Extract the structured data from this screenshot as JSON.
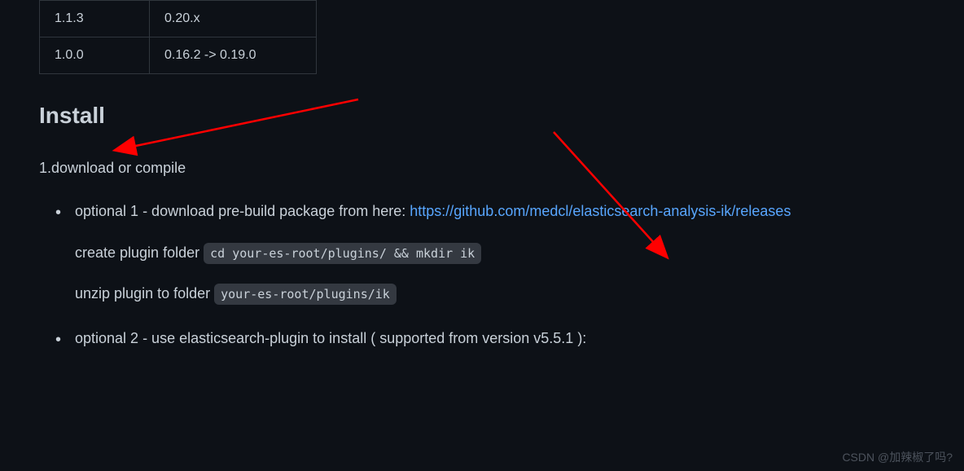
{
  "table": {
    "rows": [
      {
        "version": "1.1.3",
        "es": "0.20.x"
      },
      {
        "version": "1.0.0",
        "es": "0.16.2 -> 0.19.0"
      }
    ]
  },
  "heading": "Install",
  "section_intro": "1.download or compile",
  "item1": {
    "prefix": "optional 1 - download pre-build package from here: ",
    "link": "https://github.com/medcl/elasticsearch-analysis-ik/releases",
    "para1_text": "create plugin folder ",
    "para1_code": "cd your-es-root/plugins/ && mkdir ik",
    "para2_text": "unzip plugin to folder ",
    "para2_code": "your-es-root/plugins/ik"
  },
  "item2": {
    "text": "optional 2 - use elasticsearch-plugin to install ( supported from version v5.5.1 ):"
  },
  "watermark": "CSDN @加辣椒了吗?"
}
